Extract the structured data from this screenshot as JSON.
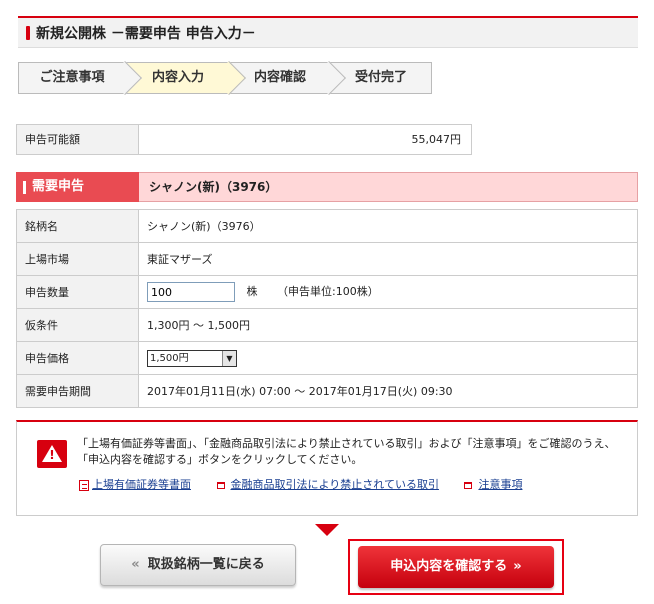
{
  "title": "新規公開株 －需要申告 申告入力－",
  "steps": [
    "ご注意事項",
    "内容入力",
    "内容確認",
    "受付完了"
  ],
  "available": {
    "label": "申告可能額",
    "value": "55,047円"
  },
  "demand": {
    "label": "需要申告",
    "value": "シャノン(新)（3976）"
  },
  "details": {
    "stock_label": "銘柄名",
    "stock_value": "シャノン(新)（3976）",
    "market_label": "上場市場",
    "market_value": "東証マザーズ",
    "qty_label": "申告数量",
    "qty_value": "100",
    "qty_unit": "株",
    "qty_note": "（申告単位:100株）",
    "cond_label": "仮条件",
    "cond_value": "1,300円 ～ 1,500円",
    "price_label": "申告価格",
    "price_value": "1,500円",
    "period_label": "需要申告期間",
    "period_value": "2017年01月11日(水) 07:00 ～ 2017年01月17日(火) 09:30"
  },
  "notice": {
    "message": "「上場有価証券等書面」、「金融商品取引法により禁止されている取引」および「注意事項」をご確認のうえ、「申込内容を確認する」ボタンをクリックしてください。",
    "links": [
      "上場有価証券等書面",
      "金融商品取引法により禁止されている取引",
      "注意事項"
    ]
  },
  "buttons": {
    "back": "取扱銘柄一覧に戻る",
    "confirm": "申込内容を確認する"
  },
  "colors": {
    "accent": "#d7000f",
    "step_active": "#fff9d6"
  }
}
